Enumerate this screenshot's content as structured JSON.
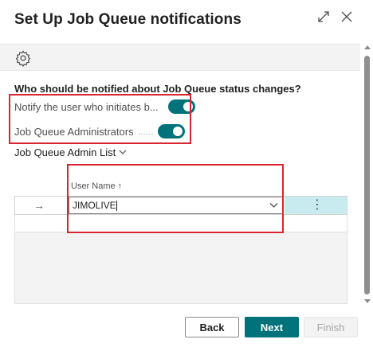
{
  "dialog": {
    "title": "Set Up Job Queue notifications"
  },
  "window_controls": {
    "expand_icon": "expand-icon",
    "close_icon": "close-icon"
  },
  "toolbar": {
    "settings_icon": "gear-icon"
  },
  "content": {
    "question": "Who should be notified about Job Queue status changes?",
    "options": [
      {
        "label": "Notify the user who initiates b...",
        "enabled": true
      },
      {
        "label": "Job Queue Administrators",
        "enabled": true
      }
    ],
    "admin_list_label": "Job Queue Admin List"
  },
  "grid": {
    "column_header": "User Name",
    "sort_indicator": "↑",
    "row_indicator": "→",
    "row_menu": "⋮",
    "rows": [
      {
        "user_name": "JIMOLIVE"
      }
    ]
  },
  "footer": {
    "back_label": "Back",
    "next_label": "Next",
    "finish_label": "Finish"
  },
  "colors": {
    "accent": "#00727a",
    "highlight_box": "#d9252f",
    "selected_row": "#c7ebee"
  }
}
